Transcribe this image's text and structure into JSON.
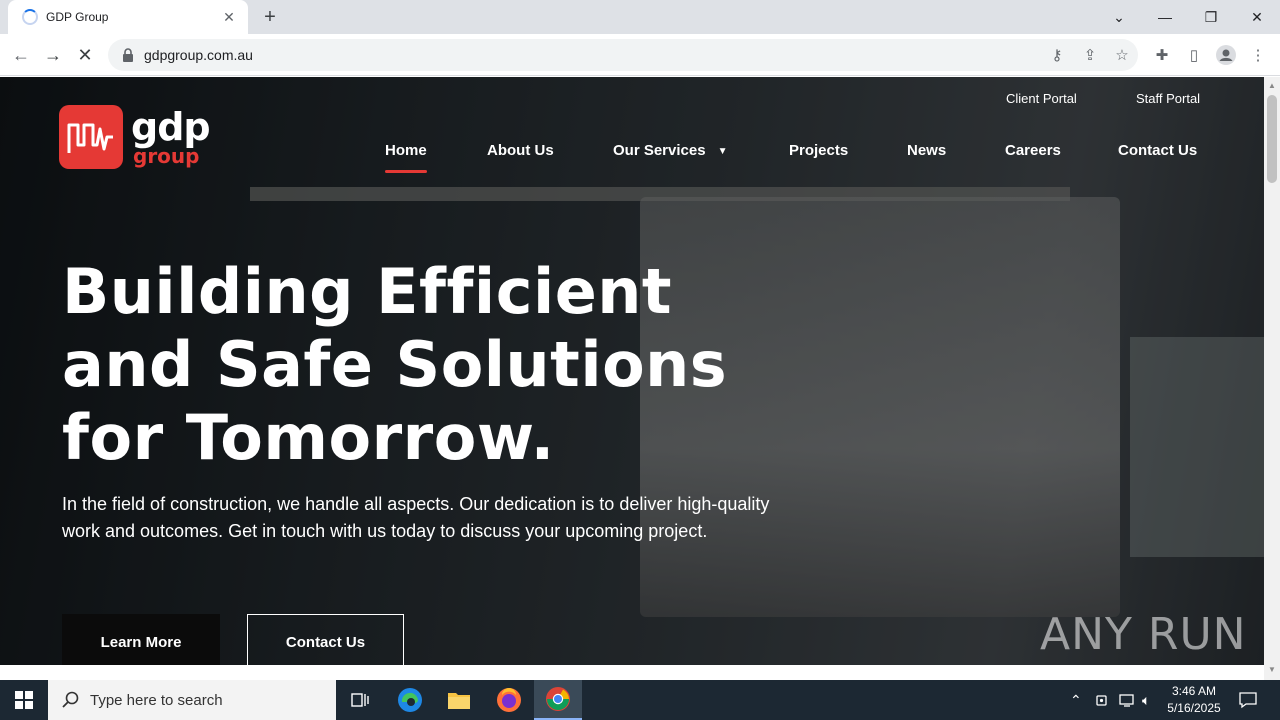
{
  "browser": {
    "tab_title": "GDP Group",
    "url": "gdpgroup.com.au"
  },
  "site": {
    "logo_word1": "gdp",
    "logo_word2": "group",
    "portals": [
      "Client Portal",
      "Staff Portal"
    ],
    "nav": [
      "Home",
      "About Us",
      "Our Services",
      "Projects",
      "News",
      "Careers",
      "Contact Us"
    ],
    "hero_title_lines": [
      "Building Efficient",
      "and Safe Solutions",
      "for Tomorrow."
    ],
    "hero_subtitle": "In the field of construction, we handle all aspects. Our dedication is to deliver high-quality work and outcomes. Get in touch with us today to discuss your upcoming project.",
    "btn_primary": "Learn More",
    "btn_secondary": "Contact Us"
  },
  "watermark": "ANY RUN",
  "taskbar": {
    "search_placeholder": "Type here to search",
    "time": "3:46 AM",
    "date": "5/16/2025"
  },
  "colors": {
    "accent": "#e53935",
    "taskbar": "#1c2833"
  }
}
